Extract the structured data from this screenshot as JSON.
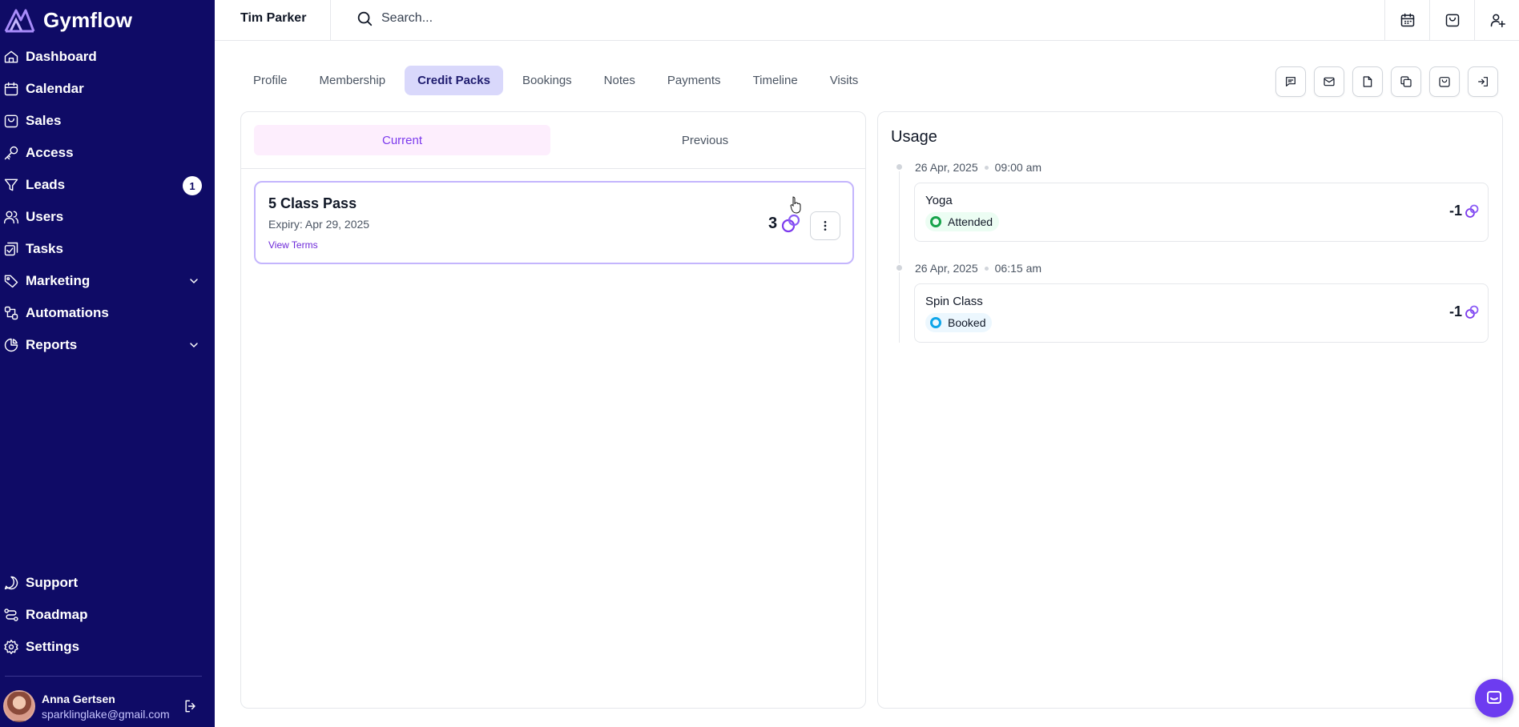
{
  "app": {
    "name": "Gymflow"
  },
  "sidebar": {
    "items": [
      {
        "label": "Dashboard",
        "icon": "home-icon"
      },
      {
        "label": "Calendar",
        "icon": "calendar-icon"
      },
      {
        "label": "Sales",
        "icon": "bag-icon"
      },
      {
        "label": "Access",
        "icon": "key-icon"
      },
      {
        "label": "Leads",
        "icon": "filter-icon",
        "badge": "1"
      },
      {
        "label": "Users",
        "icon": "users-icon"
      },
      {
        "label": "Tasks",
        "icon": "tasks-icon"
      },
      {
        "label": "Marketing",
        "icon": "tag-icon",
        "expandable": true
      },
      {
        "label": "Automations",
        "icon": "automation-icon"
      },
      {
        "label": "Reports",
        "icon": "pie-chart-icon",
        "expandable": true
      }
    ],
    "bottom_items": [
      {
        "label": "Support",
        "icon": "chat-icon"
      },
      {
        "label": "Roadmap",
        "icon": "route-icon"
      },
      {
        "label": "Settings",
        "icon": "gear-icon"
      }
    ],
    "user": {
      "name": "Anna Gertsen",
      "email": "sparklinglake@gmail.com"
    }
  },
  "topbar": {
    "member_name": "Tim Parker",
    "search_placeholder": "Search...",
    "icons": [
      "calendar-icon",
      "shopping-bag-icon",
      "add-user-icon"
    ]
  },
  "tabs": [
    "Profile",
    "Membership",
    "Credit Packs",
    "Bookings",
    "Notes",
    "Payments",
    "Timeline",
    "Visits"
  ],
  "active_tab": "Credit Packs",
  "actions": [
    "message-icon",
    "mail-icon",
    "document-icon",
    "copy-icon",
    "bag-icon",
    "sign-in-icon"
  ],
  "credit_packs": {
    "subtabs": [
      "Current",
      "Previous"
    ],
    "active_subtab": "Current",
    "packs": [
      {
        "name": "5 Class Pass",
        "expiry": "Expiry: Apr 29, 2025",
        "terms_link": "View Terms",
        "credits": "3"
      }
    ]
  },
  "usage": {
    "title": "Usage",
    "entries": [
      {
        "date": "26 Apr, 2025",
        "time": "09:00 am",
        "class": "Yoga",
        "status": "Attended",
        "credit": "-1"
      },
      {
        "date": "26 Apr, 2025",
        "time": "06:15 am",
        "class": "Spin Class",
        "status": "Booked",
        "credit": "-1"
      }
    ]
  },
  "colors": {
    "sidebar_bg": "#0f0b66",
    "accent": "#7c3aed",
    "tab_active_bg": "#d9d8fb",
    "attended": "#16a34a",
    "booked": "#0ea5e9"
  }
}
